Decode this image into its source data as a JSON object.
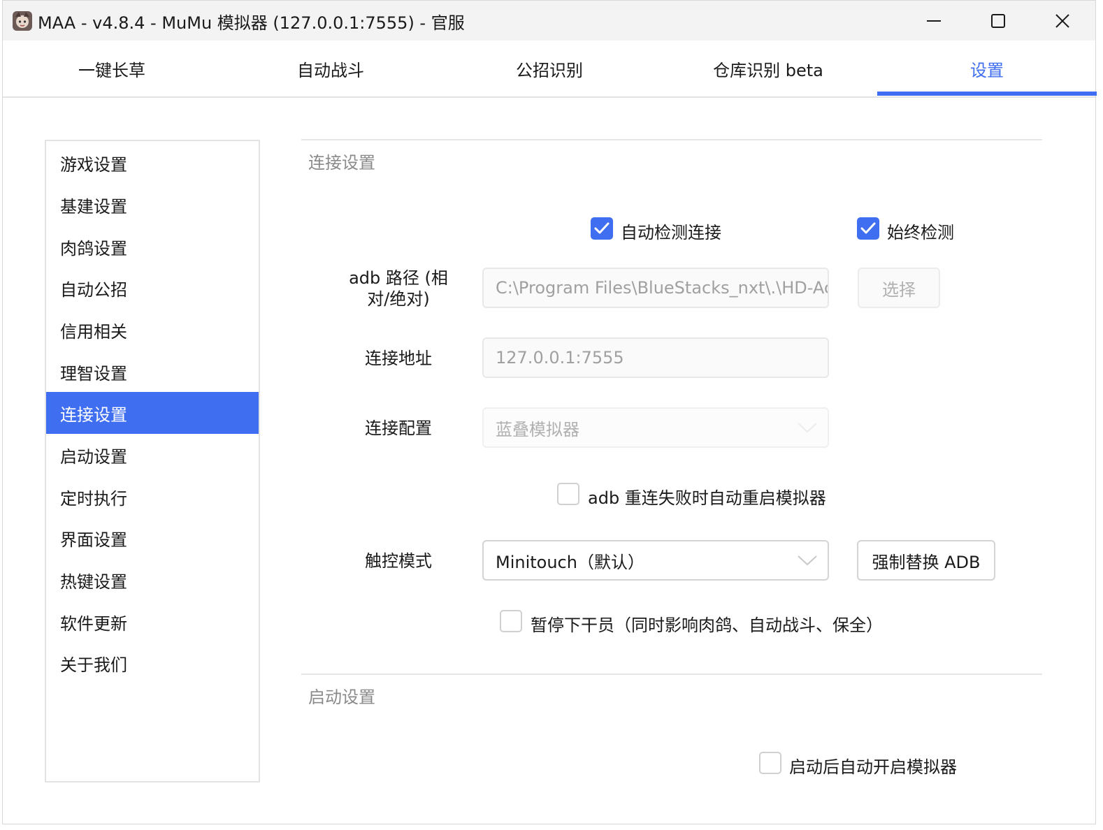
{
  "window": {
    "title": "MAA - v4.8.4 - MuMu 模拟器 (127.0.0.1:7555) - 官服",
    "accent_color": "#3f6ef0"
  },
  "tabs": [
    {
      "label": "一键长草"
    },
    {
      "label": "自动战斗"
    },
    {
      "label": "公招识别"
    },
    {
      "label": "仓库识别 beta"
    },
    {
      "label": "设置",
      "active": true
    }
  ],
  "sidenav": {
    "items": [
      {
        "label": "游戏设置"
      },
      {
        "label": "基建设置"
      },
      {
        "label": "肉鸽设置"
      },
      {
        "label": "自动公招"
      },
      {
        "label": "信用相关"
      },
      {
        "label": "理智设置"
      },
      {
        "label": "连接设置",
        "active": true
      },
      {
        "label": "启动设置"
      },
      {
        "label": "定时执行"
      },
      {
        "label": "界面设置"
      },
      {
        "label": "热键设置"
      },
      {
        "label": "软件更新"
      },
      {
        "label": "关于我们"
      }
    ]
  },
  "connection": {
    "section_title": "连接设置",
    "auto_detect": {
      "label": "自动检测连接",
      "checked": true
    },
    "always_detect": {
      "label": "始终检测",
      "checked": true
    },
    "adb_path": {
      "label_line1": "adb 路径 (相",
      "label_line2": "对/绝对)",
      "value": "C:\\Program Files\\BlueStacks_nxt\\.\\HD-Ac"
    },
    "select_button": "选择",
    "address": {
      "label": "连接地址",
      "value": "127.0.0.1:7555"
    },
    "config": {
      "label": "连接配置",
      "value": "蓝叠模拟器"
    },
    "adb_restart": {
      "label": "adb 重连失败时自动重启模拟器",
      "checked": false
    },
    "touch_mode": {
      "label": "触控模式",
      "value": "Minitouch（默认）"
    },
    "force_replace_button": "强制替换 ADB",
    "pause_operator": {
      "label": "暂停下干员（同时影响肉鸽、自动战斗、保全）",
      "checked": false
    }
  },
  "startup": {
    "section_title": "启动设置",
    "auto_start_emulator": {
      "label": "启动后自动开启模拟器",
      "checked": false
    }
  }
}
